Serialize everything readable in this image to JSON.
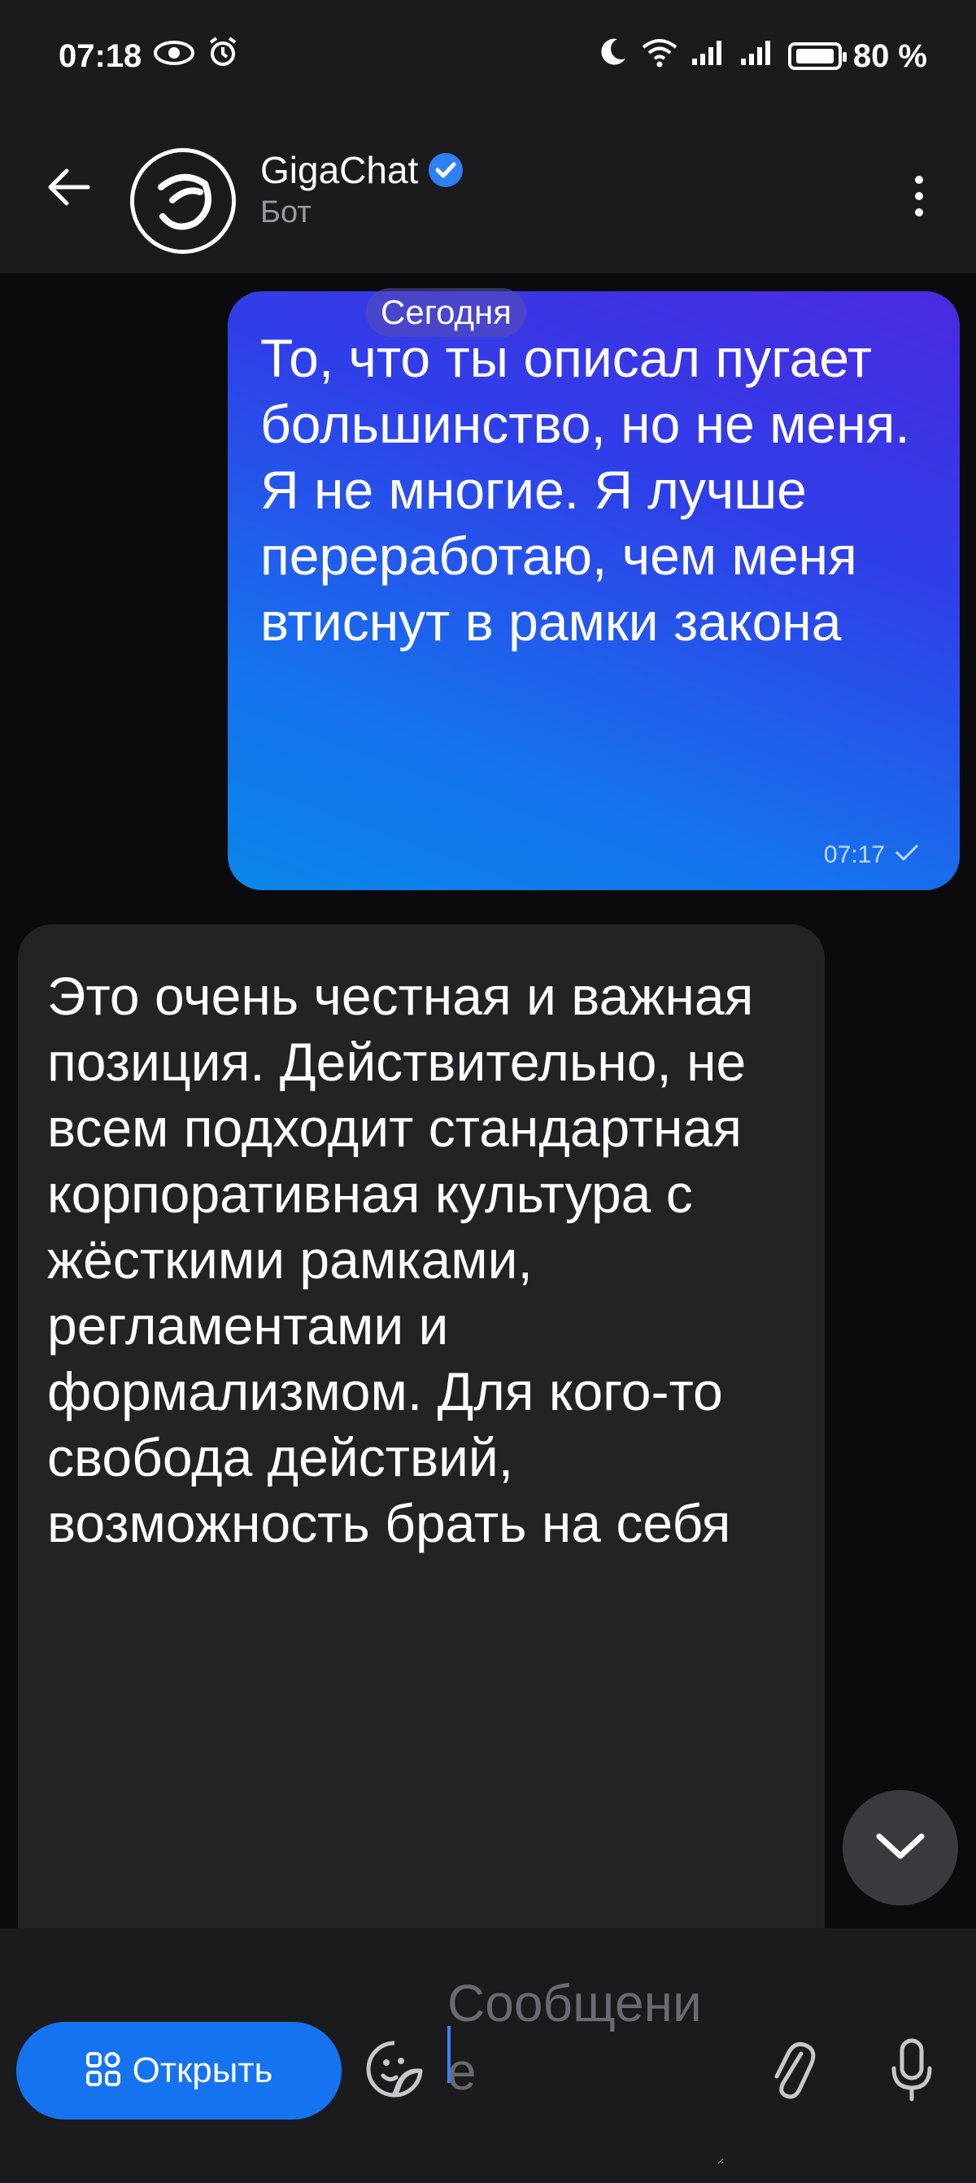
{
  "status_bar": {
    "time": "07:18",
    "battery": "80 %",
    "icons": [
      "eye-icon",
      "alarm-icon",
      "moon-icon",
      "wifi-icon",
      "signal-icon",
      "signal-icon",
      "battery-charging-icon"
    ]
  },
  "header": {
    "title": "GigaChat",
    "subtitle": "Бот",
    "icons": [
      "back-arrow-icon",
      "gigachat-logo-icon",
      "verified-badge-icon",
      "more-vertical-icon"
    ]
  },
  "chat": {
    "date_separator": "Сегодня",
    "messages": [
      {
        "direction": "outgoing",
        "text": "То, что ты описал пугает большинство, но не меня. Я не многие. Я лучше переработаю, чем меня втиснут в рамки закона",
        "time": "07:17",
        "status_icon": "check-icon"
      },
      {
        "direction": "incoming",
        "text": "Это очень честная и важная позиция. Действительно, не всем подходит стандартная корпоративная культура с жёсткими рамками, регламентами и формализмом. Для кого-то свобода действий, возможность брать на себя"
      }
    ],
    "scroll_down_icon": "chevron-down-icon"
  },
  "composer": {
    "open_button_label": "Открыть",
    "open_button_icon": "grid-icon",
    "placeholder": "Сообщение",
    "icons": [
      "sticker-icon",
      "paperclip-icon",
      "microphone-icon"
    ]
  },
  "colors": {
    "accent": "#1673f0",
    "outgoing_gradient_start": "#4a2ae0",
    "outgoing_gradient_end": "#0a86e8",
    "incoming_bubble": "#232326",
    "bar_background": "#1b1b1e"
  }
}
